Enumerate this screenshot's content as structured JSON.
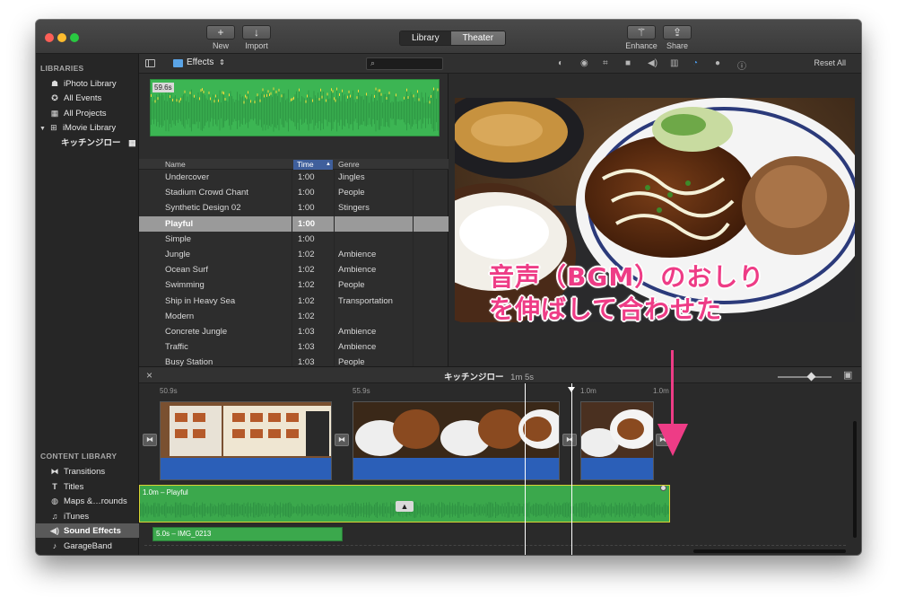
{
  "toolbar": {
    "new_label": "New",
    "import_label": "Import",
    "library_tab": "Library",
    "theater_tab": "Theater",
    "enhance_label": "Enhance",
    "share_label": "Share"
  },
  "sidebar": {
    "libraries_heading": "LIBRARIES",
    "items": [
      {
        "label": "iPhoto Library",
        "icon": "camera-icon"
      },
      {
        "label": "All Events",
        "icon": "star-icon"
      },
      {
        "label": "All Projects",
        "icon": "clapper-icon"
      },
      {
        "label": "iMovie Library",
        "icon": "grid-icon"
      },
      {
        "label": "キッチンジロー",
        "icon": "clapper-icon"
      }
    ],
    "content_heading": "CONTENT LIBRARY",
    "content_items": [
      {
        "label": "Transitions",
        "icon": "transitions-icon"
      },
      {
        "label": "Titles",
        "icon": "titles-icon"
      },
      {
        "label": "Maps &…rounds",
        "icon": "globe-icon"
      },
      {
        "label": "iTunes",
        "icon": "music-note-icon"
      },
      {
        "label": "Sound Effects",
        "icon": "speaker-icon"
      },
      {
        "label": "GarageBand",
        "icon": "guitar-icon"
      }
    ]
  },
  "browser": {
    "category": "Effects",
    "waveform_duration": "59.6s",
    "columns": {
      "name": "Name",
      "time": "Time",
      "genre": "Genre"
    },
    "rows": [
      {
        "name": "Undercover",
        "time": "1:00",
        "genre": "Jingles"
      },
      {
        "name": "Stadium Crowd Chant",
        "time": "1:00",
        "genre": "People"
      },
      {
        "name": "Synthetic Design 02",
        "time": "1:00",
        "genre": "Stingers"
      },
      {
        "name": "Playful",
        "time": "1:00",
        "genre": ""
      },
      {
        "name": "Simple",
        "time": "1:00",
        "genre": ""
      },
      {
        "name": "Jungle",
        "time": "1:02",
        "genre": "Ambience"
      },
      {
        "name": "Ocean Surf",
        "time": "1:02",
        "genre": "Ambience"
      },
      {
        "name": "Swimming",
        "time": "1:02",
        "genre": "People"
      },
      {
        "name": "Ship in Heavy Sea",
        "time": "1:02",
        "genre": "Transportation"
      },
      {
        "name": "Modern",
        "time": "1:02",
        "genre": ""
      },
      {
        "name": "Concrete Jungle",
        "time": "1:03",
        "genre": "Ambience"
      },
      {
        "name": "Traffic",
        "time": "1:03",
        "genre": "Ambience"
      },
      {
        "name": "Busy Station",
        "time": "1:03",
        "genre": "People"
      }
    ],
    "selected_row": 3
  },
  "viewer": {
    "reset_label": "Reset All",
    "overlay_line1": "音声（BGM）のおしり",
    "overlay_line2": "を伸ばして合わせた"
  },
  "timeline": {
    "project_name": "キッチンジロー",
    "duration": "1m 5s",
    "clip_times": [
      "50.9s",
      "55.9s",
      "1.0m",
      "1.0m"
    ],
    "bgm_label": "1.0m – Playful",
    "clip2_label": "5.0s – IMG_0213"
  },
  "colors": {
    "accent_pink": "#ee3c86",
    "audio_green": "#3ba84c",
    "clip_blue": "#2b5fb8"
  }
}
